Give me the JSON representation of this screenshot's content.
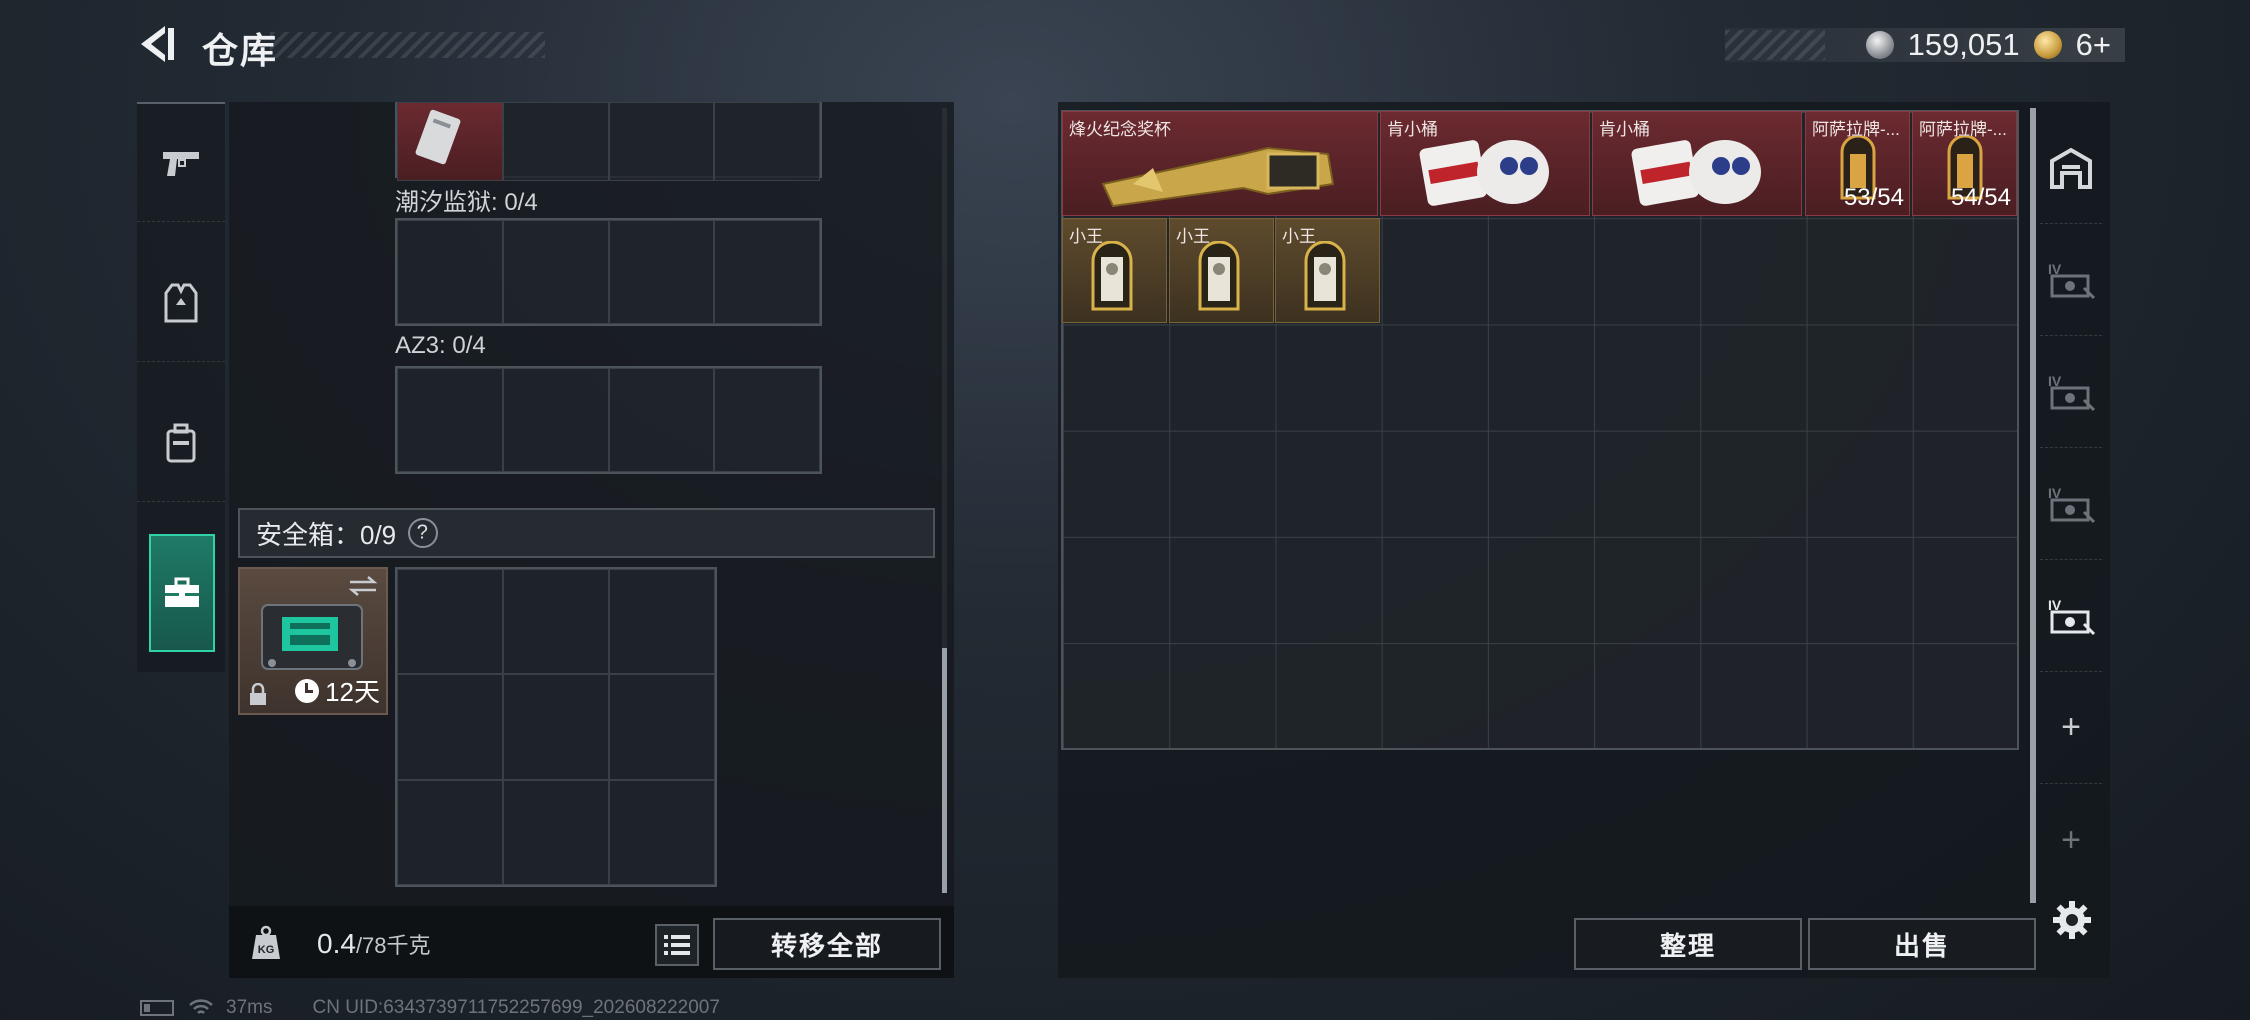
{
  "header": {
    "title": "仓库",
    "silver_amount": "159,051",
    "gold_amount": "6+"
  },
  "rail": {
    "items": [
      {
        "icon": "pistol-icon"
      },
      {
        "icon": "vest-icon"
      },
      {
        "icon": "backpack-icon"
      },
      {
        "icon": "toolbox-icon",
        "active": true
      }
    ]
  },
  "left": {
    "sections": [
      {
        "label": "潮汐监狱: 0/4"
      },
      {
        "label": "AZ3: 0/4"
      }
    ],
    "safebox": {
      "label": "安全箱：0/9",
      "help": "?",
      "days": "12天"
    },
    "weight": {
      "value": "0.4",
      "capacity": "/78千克",
      "icon_text": "KG"
    },
    "transfer_all": "转移全部"
  },
  "stash": {
    "items": [
      {
        "name": "烽火纪念奖杯",
        "rarity": "red",
        "count": ""
      },
      {
        "name": "肯小桶",
        "rarity": "red",
        "count": ""
      },
      {
        "name": "肯小桶",
        "rarity": "red",
        "count": ""
      },
      {
        "name": "阿萨拉牌-...",
        "rarity": "red",
        "count": "53/54"
      },
      {
        "name": "阿萨拉牌-...",
        "rarity": "red",
        "count": "54/54"
      },
      {
        "name": "小王",
        "rarity": "gold",
        "count": ""
      },
      {
        "name": "小王",
        "rarity": "gold",
        "count": ""
      },
      {
        "name": "小王",
        "rarity": "gold",
        "count": ""
      }
    ],
    "side_tabs": [
      "home-icon",
      "case-iv-icon",
      "case-iv-icon",
      "case-iv-icon",
      "case-iv-icon"
    ],
    "plus": "+",
    "sort": "整理",
    "sell": "出售"
  },
  "status": {
    "ping": "37ms",
    "uid": "CN UID:6343739711752257699_202608222007"
  },
  "colors": {
    "accent": "#2fd3a7",
    "red_rarity": "#6b2a30",
    "gold_rarity": "#5e4b2d"
  }
}
